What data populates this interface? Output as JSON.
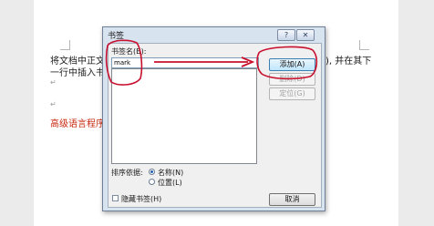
{
  "document": {
    "line1_left": "将文档中正文",
    "line1_right": "), 并在其下",
    "line2": "一行中插入书签",
    "line5": "高级语言程序设"
  },
  "dialog": {
    "title": "书签",
    "help_icon": "?",
    "close_icon": "✕",
    "name_label": "书签名(B):",
    "name_value": "mark",
    "buttons": {
      "add": "添加(A)",
      "delete": "删除(D)",
      "goto": "定位(G)",
      "cancel": "取消"
    },
    "sort_label": "排序依据:",
    "sort_options": [
      "名称(N)",
      "位置(L)"
    ],
    "sort_selected": "名称(N)",
    "hidden_label": "隐藏书签(H)"
  },
  "colors": {
    "annotation": "#c8102e",
    "red_text": "#c8280f",
    "dialog_frame": "#d8e3f0"
  }
}
